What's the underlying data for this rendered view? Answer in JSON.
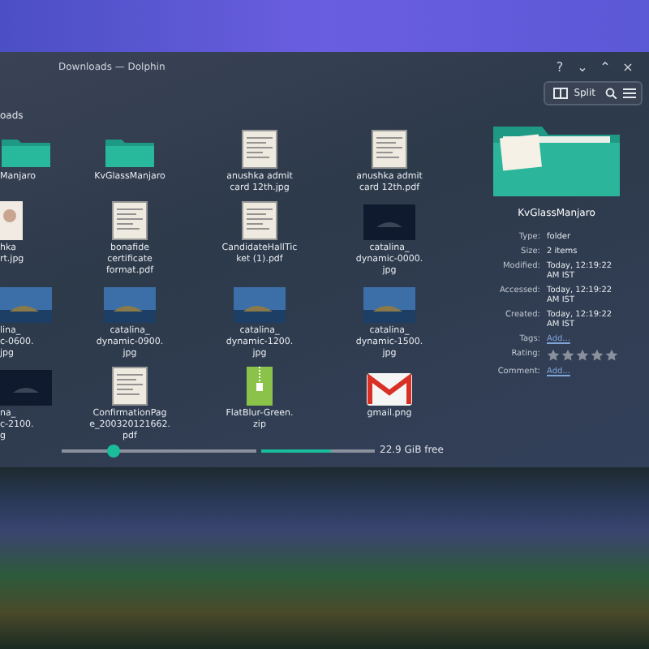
{
  "window": {
    "title": "Downloads — Dolphin",
    "controls": [
      "?",
      "⌄",
      "⌃",
      "×"
    ]
  },
  "toolbar": {
    "split_label": "Split"
  },
  "breadcrumb": "oads",
  "files": [
    {
      "name": "Manjaro",
      "kind": "folder",
      "cut": true
    },
    {
      "name": "KvGlassManjaro",
      "kind": "folder",
      "cut": false
    },
    {
      "name": "anushka admit\ncard 12th.jpg",
      "kind": "document",
      "cut": false
    },
    {
      "name": "anushka admit\ncard 12th.pdf",
      "kind": "document",
      "cut": false
    },
    {
      "name": "hka\nrt.jpg",
      "kind": "portrait",
      "cut": true
    },
    {
      "name": "bonafide\ncertificate\nformat.pdf",
      "kind": "document",
      "cut": false
    },
    {
      "name": "CandidateHallTic\nket (1).pdf",
      "kind": "document",
      "cut": false
    },
    {
      "name": "catalina_\ndynamic-0000.\njpg",
      "kind": "photo-dark",
      "cut": false
    },
    {
      "name": "lina_\nc-0600.\njpg",
      "kind": "photo",
      "cut": true
    },
    {
      "name": "catalina_\ndynamic-0900.\njpg",
      "kind": "photo",
      "cut": false
    },
    {
      "name": "catalina_\ndynamic-1200.\njpg",
      "kind": "photo",
      "cut": false
    },
    {
      "name": "catalina_\ndynamic-1500.\njpg",
      "kind": "photo",
      "cut": false
    },
    {
      "name": "na_\nc-2100.\ng",
      "kind": "photo-dark",
      "cut": true
    },
    {
      "name": "ConfirmationPag\ne_200320121662.\npdf",
      "kind": "document",
      "cut": false
    },
    {
      "name": "FlatBlur-Green.\nzip",
      "kind": "zip",
      "cut": false
    },
    {
      "name": "gmail.png",
      "kind": "gmail",
      "cut": false
    }
  ],
  "info": {
    "name": "KvGlassManjaro",
    "properties": [
      {
        "label": "Type:",
        "value": "folder",
        "kind": "text"
      },
      {
        "label": "Size:",
        "value": "2 items",
        "kind": "text"
      },
      {
        "label": "Modified:",
        "value": "Today, 12:19:22\nAM IST",
        "kind": "text"
      },
      {
        "label": "Accessed:",
        "value": "Today, 12:19:22\nAM IST",
        "kind": "text"
      },
      {
        "label": "Created:",
        "value": "Today, 12:19:22\nAM IST",
        "kind": "text"
      },
      {
        "label": "Tags:",
        "value": "Add...",
        "kind": "link"
      },
      {
        "label": "Rating:",
        "stars": 0,
        "kind": "rating"
      },
      {
        "label": "Comment:",
        "value": "Add...",
        "kind": "link"
      }
    ]
  },
  "status": {
    "zoom": {
      "level": 0.27
    },
    "space": {
      "level": 0.62,
      "reading": "22.9 GiB free"
    }
  }
}
